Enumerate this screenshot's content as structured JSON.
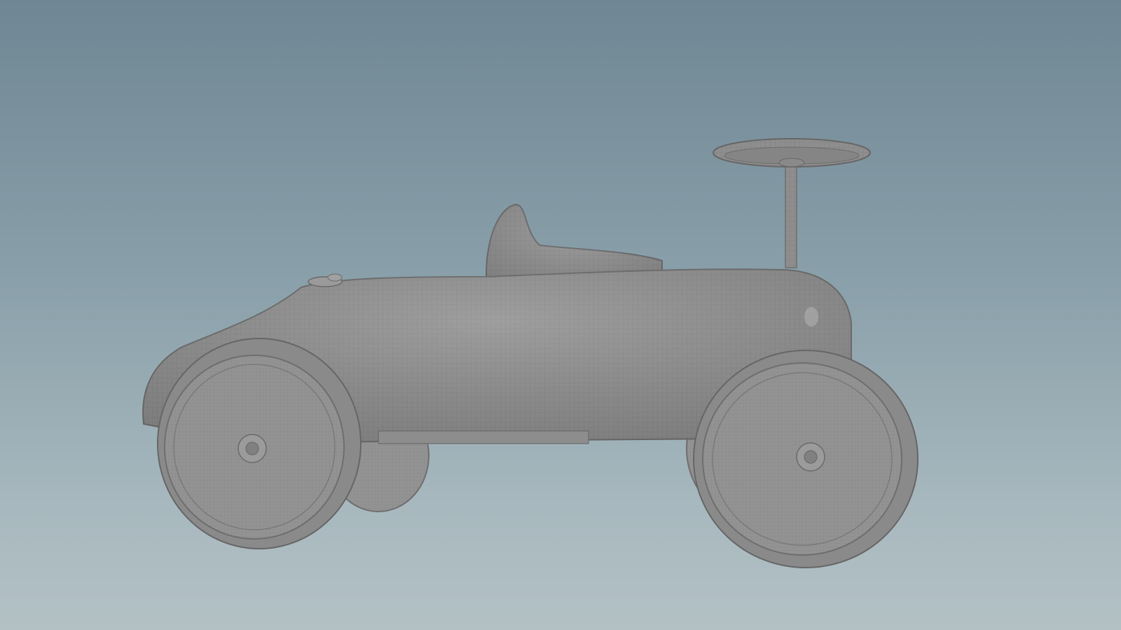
{
  "viewport": {
    "background_top": "#6f8794",
    "background_bottom": "#b3c1c5"
  },
  "model": {
    "shading": "wireframe-on-shaded",
    "object": "ride-on toy car",
    "body_color": "#8f8f8f",
    "wire_color": "#7a7a7a"
  }
}
